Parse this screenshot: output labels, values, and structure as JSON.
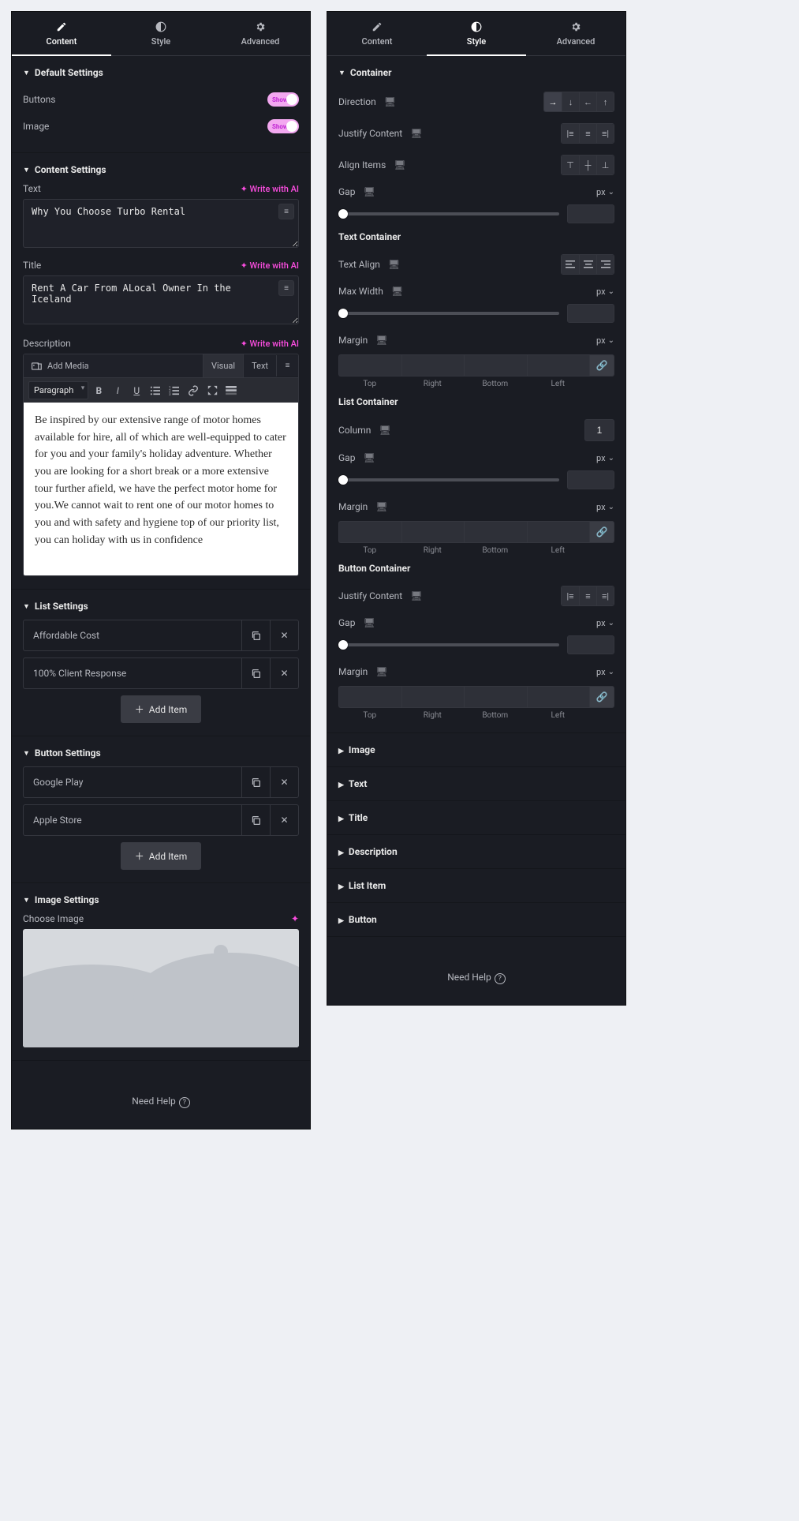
{
  "tabs": {
    "content": "Content",
    "style": "Style",
    "advanced": "Advanced"
  },
  "content_panel": {
    "default_settings": {
      "title": "Default Settings",
      "buttons_label": "Buttons",
      "image_label": "Image",
      "toggle_text": "Show"
    },
    "content_settings": {
      "title": "Content Settings",
      "text_label": "Text",
      "text_value": "Why You Choose Turbo Rental",
      "title_label": "Title",
      "title_value": "Rent A Car From ALocal Owner In the Iceland",
      "description_label": "Description",
      "write_ai": "Write with AI",
      "add_media": "Add Media",
      "editor_tabs": {
        "visual": "Visual",
        "text": "Text"
      },
      "format_select": "Paragraph",
      "description_value": "Be inspired by our extensive range of motor homes available for hire, all of which are well-equipped to cater for you and your family's holiday adventure. Whether you are looking for a short break or a more extensive tour further afield, we have the perfect motor home for you.We cannot wait to rent one of our motor homes to you and with safety and hygiene top of our priority list, you can holiday with us in confidence"
    },
    "list_settings": {
      "title": "List Settings",
      "items": [
        "Affordable Cost",
        "100% Client Response"
      ],
      "add_item": "Add Item"
    },
    "button_settings": {
      "title": "Button Settings",
      "items": [
        "Google Play",
        "Apple Store"
      ],
      "add_item": "Add Item"
    },
    "image_settings": {
      "title": "Image Settings",
      "choose_image": "Choose Image"
    },
    "need_help": "Need Help"
  },
  "style_panel": {
    "container": {
      "title": "Container",
      "direction": "Direction",
      "justify": "Justify Content",
      "align": "Align Items",
      "gap": "Gap",
      "unit": "px"
    },
    "text_container": {
      "title": "Text Container",
      "text_align": "Text Align",
      "max_width": "Max Width",
      "margin": "Margin",
      "unit": "px",
      "sides": {
        "top": "Top",
        "right": "Right",
        "bottom": "Bottom",
        "left": "Left"
      }
    },
    "list_container": {
      "title": "List Container",
      "column": "Column",
      "column_value": "1",
      "gap": "Gap",
      "margin": "Margin",
      "unit": "px"
    },
    "button_container": {
      "title": "Button Container",
      "justify": "Justify Content",
      "gap": "Gap",
      "margin": "Margin",
      "unit": "px"
    },
    "collapsed": [
      "Image",
      "Text",
      "Title",
      "Description",
      "List Item",
      "Button"
    ],
    "need_help": "Need Help"
  }
}
